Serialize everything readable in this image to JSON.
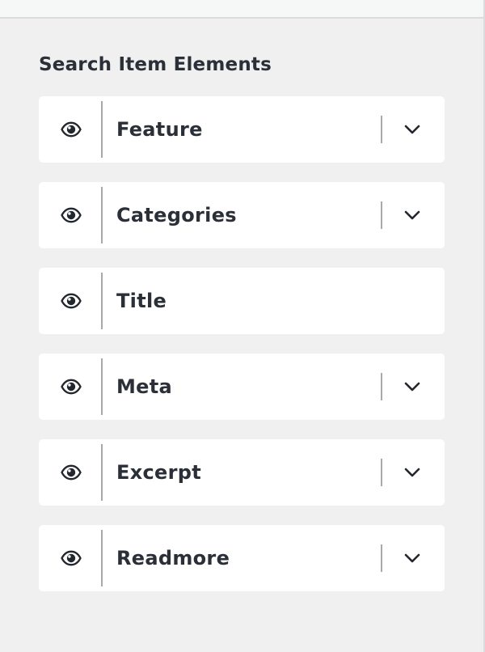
{
  "panel": {
    "section_title": "Search Item Elements",
    "items": [
      {
        "label": "Feature",
        "has_settings": true,
        "visible": true
      },
      {
        "label": "Categories",
        "has_settings": true,
        "visible": true
      },
      {
        "label": "Title",
        "has_settings": false,
        "visible": true
      },
      {
        "label": "Meta",
        "has_settings": true,
        "visible": true
      },
      {
        "label": "Excerpt",
        "has_settings": true,
        "visible": true
      },
      {
        "label": "Readmore",
        "has_settings": true,
        "visible": true
      }
    ]
  },
  "icons": {
    "visibility": "eye-icon",
    "expand": "chevron-down-icon"
  },
  "colors": {
    "background": "#f0f0f1",
    "card": "#ffffff",
    "text": "#2b2f38",
    "divider": "#a7aaad"
  }
}
